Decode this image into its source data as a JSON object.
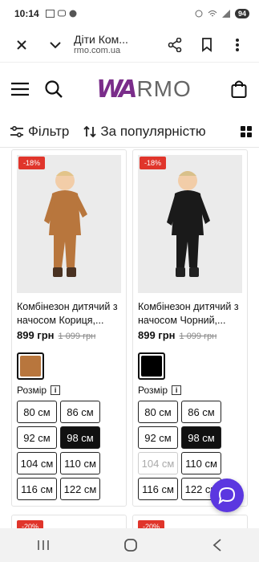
{
  "status": {
    "time": "10:14",
    "battery": "94"
  },
  "browser": {
    "title": "Діти Ком...",
    "url": "rmo.com.ua"
  },
  "toolbar": {
    "filter": "Фільтр",
    "sort": "За популярністю"
  },
  "products": [
    {
      "badge": "-18%",
      "title": "Комбінезон дитячий з начосом Кориця,...",
      "price": "899 грн",
      "old_price": "1 099 грн",
      "color": "#b8763d",
      "size_label": "Розмір",
      "sizes": [
        "80 см",
        "86 см",
        "92 см",
        "98 см",
        "104 см",
        "110 см",
        "116 см",
        "122 см"
      ]
    },
    {
      "badge": "-18%",
      "title": "Комбінезон дитячий з начосом Чорний,...",
      "price": "899 грн",
      "old_price": "1 099 грн",
      "color": "#000000",
      "size_label": "Розмір",
      "sizes": [
        "80 см",
        "86 см",
        "92 см",
        "98 см",
        "104 см",
        "110 см",
        "116 см",
        "122 см"
      ]
    },
    {
      "badge": "-20%"
    },
    {
      "badge": "-20%"
    }
  ],
  "logo": {
    "mark": "WA",
    "rest": "RMO"
  },
  "info_glyph": "i"
}
